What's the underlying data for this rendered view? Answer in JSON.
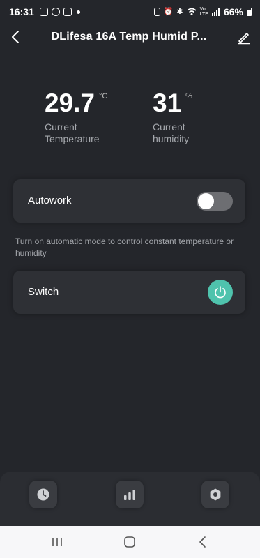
{
  "status_bar": {
    "time": "16:31",
    "battery_percent": "66%",
    "left_icons": [
      "instagram-icon",
      "facebook-icon",
      "gallery-icon",
      "dot-icon"
    ],
    "right_icons": [
      "battery-saver-icon",
      "alarm-icon",
      "bluetooth-icon",
      "wifi-icon",
      "volte-icon",
      "signal-icon",
      "battery-icon"
    ]
  },
  "header": {
    "title": "DLifesa 16A Temp Humid P...",
    "back_icon": "chevron-left-icon",
    "edit_icon": "pencil-icon"
  },
  "readings": {
    "temperature": {
      "value": "29.7",
      "unit": "°C",
      "label": "Current\nTemperature"
    },
    "humidity": {
      "value": "31",
      "unit": "%",
      "label": "Current\nhumidity"
    }
  },
  "autowork": {
    "label": "Autowork",
    "enabled": false
  },
  "hint": "Turn on automatic mode to control constant temperature or humidity",
  "switch": {
    "label": "Switch",
    "on": true,
    "accent": "#4fc3ad"
  },
  "dock": {
    "items": [
      {
        "icon": "clock-icon"
      },
      {
        "icon": "bar-chart-icon"
      },
      {
        "icon": "settings-icon"
      }
    ]
  },
  "nav": {
    "items": [
      "recents",
      "home",
      "back"
    ]
  },
  "colors": {
    "background": "#24262b",
    "card": "#2e3035",
    "accent": "#4fc3ad"
  }
}
